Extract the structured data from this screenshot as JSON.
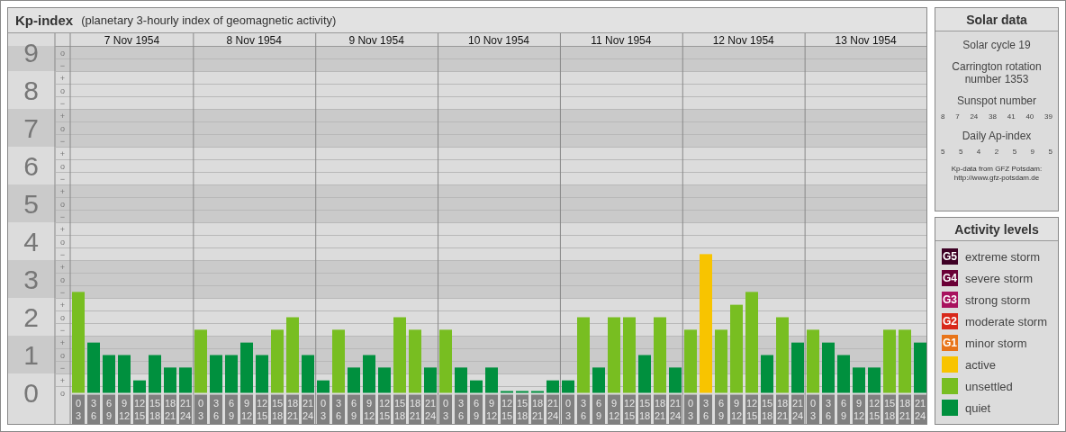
{
  "kp_panel": {
    "subtitle": "(planetary 3-hourly index of geomagnetic activity)",
    "days": [
      "7 Nov 1954",
      "8 Nov 1954",
      "9 Nov 1954",
      "10 Nov 1954",
      "11 Nov 1954",
      "12 Nov 1954",
      "13 Nov 1954"
    ],
    "minor_labels": [
      "o",
      "−",
      "+",
      "o",
      "−",
      "+",
      "o",
      "−",
      "+",
      "o",
      "−",
      "+",
      "o",
      "−",
      "+",
      "o",
      "−",
      "+",
      "o",
      "−",
      "+",
      "o",
      "−",
      "+",
      "o",
      "−",
      "+",
      "o"
    ],
    "chart_data": {
      "type": "bar",
      "title": "Kp-index",
      "yticks": [
        0,
        1,
        2,
        3,
        4,
        5,
        6,
        7,
        8,
        9
      ],
      "ylim": [
        0,
        9
      ],
      "grid": true,
      "categories": [
        "0\n3",
        "3\n6",
        "6\n9",
        "9\n12",
        "12\n15",
        "15\n18",
        "18\n21",
        "21\n24",
        "0\n3",
        "3\n6",
        "6\n9",
        "9\n12",
        "12\n15",
        "15\n18",
        "18\n21",
        "21\n24",
        "0\n3",
        "3\n6",
        "6\n9",
        "9\n12",
        "12\n15",
        "15\n18",
        "18\n21",
        "21\n24",
        "0\n3",
        "3\n6",
        "6\n9",
        "9\n12",
        "12\n15",
        "15\n18",
        "18\n21",
        "21\n24",
        "0\n3",
        "3\n6",
        "6\n9",
        "9\n12",
        "12\n15",
        "15\n18",
        "18\n21",
        "21\n24",
        "0\n3",
        "3\n6",
        "6\n9",
        "9\n12",
        "12\n15",
        "15\n18",
        "18\n21",
        "21\n24",
        "0\n3",
        "3\n6",
        "6\n9",
        "9\n12",
        "12\n15",
        "15\n18",
        "18\n21",
        "21\n24"
      ],
      "series": [
        {
          "values": [
            2.67,
            1.33,
            1,
            1,
            0.33,
            1,
            0.67,
            0.67,
            1.67,
            1,
            1,
            1.33,
            1,
            1.67,
            2,
            1,
            0.33,
            1.67,
            0.67,
            1,
            0.67,
            2,
            1.67,
            0.67,
            1.67,
            0.67,
            0.33,
            0.67,
            0,
            0,
            0,
            0.33,
            0.33,
            2,
            0.67,
            2,
            2,
            1,
            2,
            0.67,
            1.67,
            3.67,
            1.67,
            2.33,
            2.67,
            1,
            2,
            1.33,
            1.67,
            1.33,
            1,
            0.67,
            0.67,
            1.67,
            1.67,
            1.33
          ]
        }
      ]
    }
  },
  "solar_data": {
    "title": "Solar data",
    "cycle": "Solar cycle 19",
    "rotation": "Carrington rotation number 1353",
    "sunspot_title": "Sunspot number",
    "sunspot_values": [
      "8",
      "7",
      "24",
      "38",
      "41",
      "40",
      "39"
    ],
    "ap_title": "Daily Ap-index",
    "ap_values": [
      "5",
      "5",
      "4",
      "2",
      "5",
      "9",
      "5"
    ],
    "source": "Kp-data from GFZ Potsdam:",
    "source_url": "http://www.gfz-potsdam.de"
  },
  "activity_levels": {
    "title": "Activity levels",
    "items": [
      {
        "badge": "G5",
        "label": "extreme storm",
        "color": "#3d0024"
      },
      {
        "badge": "G4",
        "label": "severe storm",
        "color": "#6a0036"
      },
      {
        "badge": "G3",
        "label": "strong storm",
        "color": "#a8125e"
      },
      {
        "badge": "G2",
        "label": "moderate storm",
        "color": "#d8281a"
      },
      {
        "badge": "G1",
        "label": "minor storm",
        "color": "#e8751a"
      },
      {
        "label": "active",
        "color": "#f8c400"
      },
      {
        "label": "unsettled",
        "color": "#78be21"
      },
      {
        "label": "quiet",
        "color": "#00903e"
      }
    ]
  }
}
